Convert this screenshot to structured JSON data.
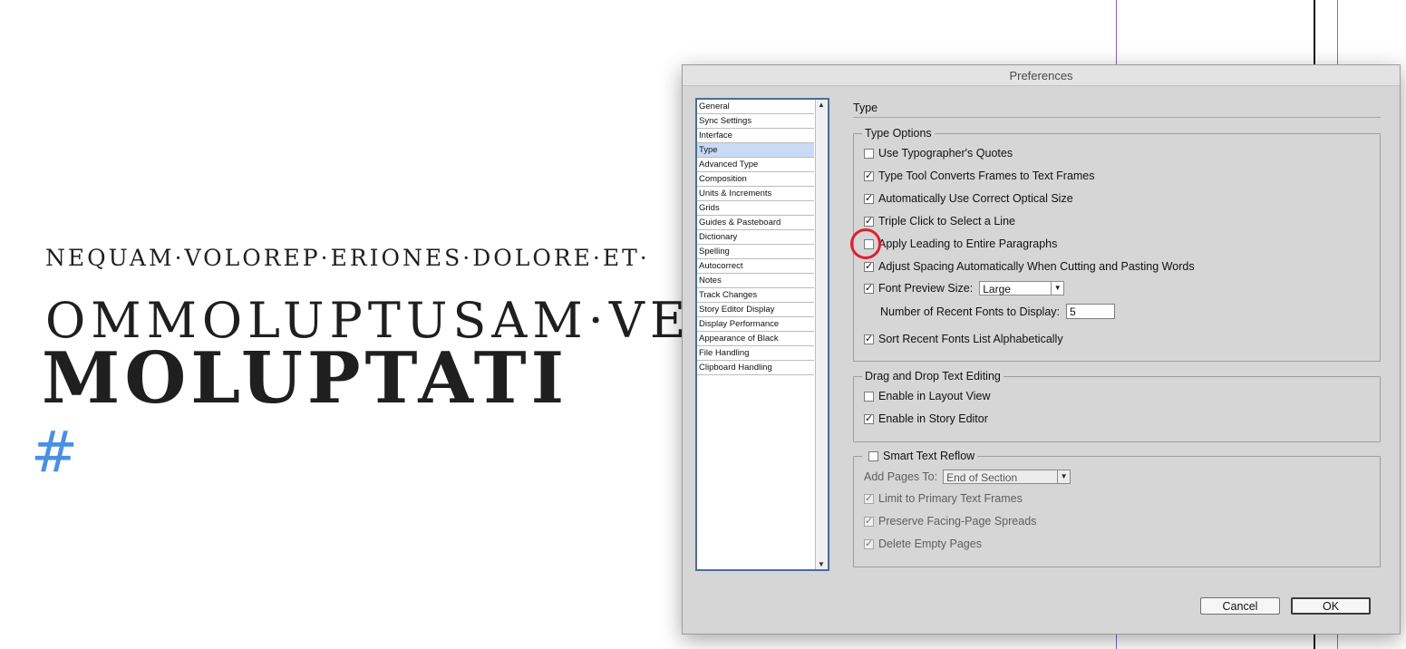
{
  "document": {
    "line1": "NEQUAM·VOLOREP·ERIONES·DOLORE·ET·",
    "line2": "OMMOLUPTUSAM·VE",
    "line3": "MOLUPTATI",
    "hash": "#"
  },
  "dialog": {
    "title": "Preferences",
    "categories": [
      "General",
      "Sync Settings",
      "Interface",
      "Type",
      "Advanced Type",
      "Composition",
      "Units & Increments",
      "Grids",
      "Guides & Pasteboard",
      "Dictionary",
      "Spelling",
      "Autocorrect",
      "Notes",
      "Track Changes",
      "Story Editor Display",
      "Display Performance",
      "Appearance of Black",
      "File Handling",
      "Clipboard Handling"
    ],
    "selected_category": "Type",
    "panel_title": "Type",
    "type_options": {
      "legend": "Type Options",
      "use_typographers_quotes": {
        "label": "Use Typographer's Quotes",
        "checked": false
      },
      "type_tool_converts": {
        "label": "Type Tool Converts Frames to Text Frames",
        "checked": true
      },
      "auto_optical_size": {
        "label": "Automatically Use Correct Optical Size",
        "checked": true
      },
      "triple_click": {
        "label": "Triple Click to Select a Line",
        "checked": true
      },
      "apply_leading": {
        "label": "Apply Leading to Entire Paragraphs",
        "checked": false
      },
      "adjust_spacing": {
        "label": "Adjust Spacing Automatically When Cutting and Pasting Words",
        "checked": true
      },
      "font_preview": {
        "label": "Font Preview Size:",
        "checked": true,
        "value": "Large"
      },
      "recent_fonts": {
        "label": "Number of Recent Fonts to Display:",
        "value": "5"
      },
      "sort_recent": {
        "label": "Sort Recent Fonts List Alphabetically",
        "checked": true
      }
    },
    "drag_drop": {
      "legend": "Drag and Drop Text Editing",
      "layout_view": {
        "label": "Enable in Layout View",
        "checked": false
      },
      "story_editor": {
        "label": "Enable in Story Editor",
        "checked": true
      }
    },
    "smart_reflow": {
      "legend": "Smart Text Reflow",
      "checked": false,
      "add_pages_label": "Add Pages To:",
      "add_pages_value": "End of Section",
      "limit_primary": {
        "label": "Limit to Primary Text Frames",
        "checked": true
      },
      "preserve_facing": {
        "label": "Preserve Facing-Page Spreads",
        "checked": true
      },
      "delete_empty": {
        "label": "Delete Empty Pages",
        "checked": true
      }
    },
    "buttons": {
      "cancel": "Cancel",
      "ok": "OK"
    }
  }
}
